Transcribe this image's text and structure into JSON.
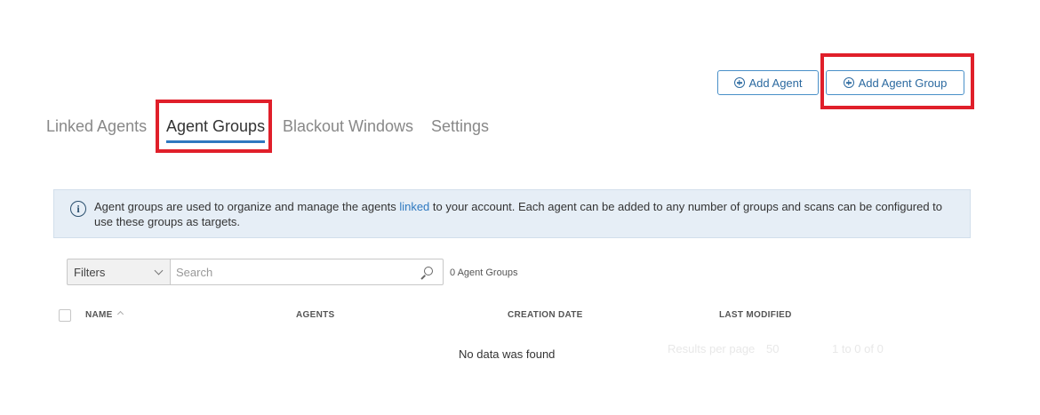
{
  "toolbar": {
    "add_agent_label": "Add Agent",
    "add_group_label": "Add Agent Group"
  },
  "tabs": [
    {
      "label": "Linked Agents"
    },
    {
      "label": "Agent Groups"
    },
    {
      "label": "Blackout Windows"
    },
    {
      "label": "Settings"
    }
  ],
  "banner": {
    "text_before": "Agent groups are used to organize and manage the agents ",
    "link": "linked",
    "text_after": " to your account. Each agent can be added to any number of groups and scans can be configured to use these groups as targets."
  },
  "filter": {
    "label": "Filters",
    "search_placeholder": "Search",
    "count": "0 Agent Groups"
  },
  "table": {
    "columns": [
      "NAME",
      "AGENTS",
      "CREATION DATE",
      "LAST MODIFIED"
    ],
    "empty_text": "No data was found"
  },
  "pagination": {
    "results_label": "Results per page",
    "per_page": "50",
    "range": "1 to 0 of 0"
  },
  "colors": {
    "accent": "#2f79c0",
    "highlight": "#e01f2a",
    "banner_bg": "#e6eef6"
  },
  "icons": [
    "plus-circle-icon",
    "info-icon",
    "search-icon",
    "chevron-down-icon",
    "sort-up-icon"
  ]
}
